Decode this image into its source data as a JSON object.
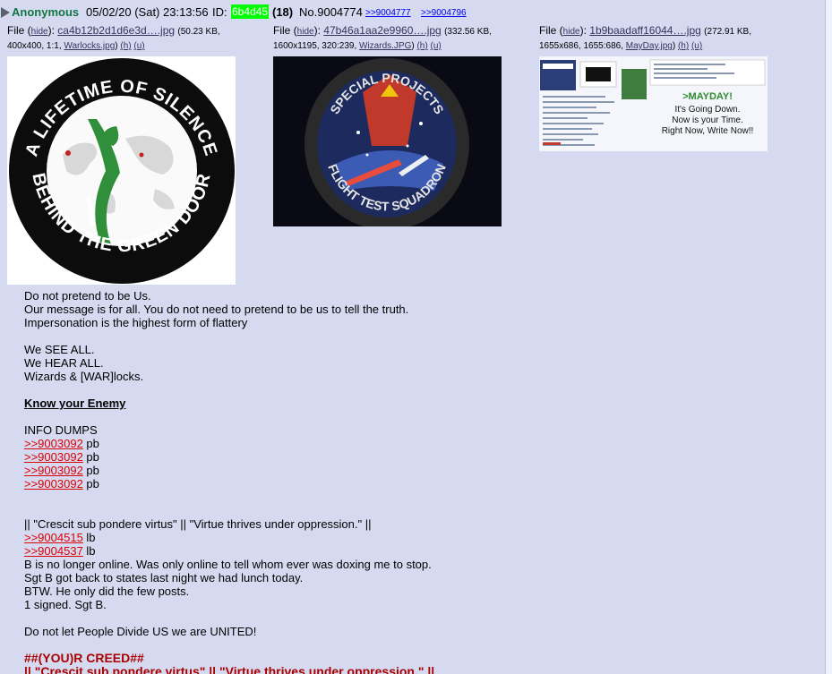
{
  "post": {
    "name": "Anonymous",
    "date": "05/02/20 (Sat) 23:13:56",
    "id_label": "ID:",
    "id": "6b4d45",
    "count": "(18)",
    "number": "No.9004774",
    "backlinks": [
      ">>9004777",
      ">>9004796"
    ]
  },
  "files": [
    {
      "label": "File (",
      "hide": "hide",
      "sep": "):",
      "name": "ca4b12b2d1d6e3d….jpg",
      "size": "(50.23 KB,",
      "dims": "400x400, 1:1,",
      "orig": "Warlocks.jpg",
      "h": "(h)",
      "u": "(u)",
      "image": {
        "ring_top_text": "A LIFETIME OF SILENCE",
        "ring_bottom_text": "BEHIND THE GREEN DOOR",
        "colors": {
          "ring": "#0c0c0c",
          "map": "#d8d8d8",
          "figure": "#2f8f3b",
          "accent": "#c81e1e"
        }
      }
    },
    {
      "label": "File (",
      "hide": "hide",
      "sep": "):",
      "name": "47b46a1aa2e9960….jpg",
      "size": "(332.56 KB,",
      "dims": "1600x1195, 320:239,",
      "orig": "Wizards.JPG",
      "h": "(h)",
      "u": "(u)",
      "image": {
        "top_text": "SPECIAL PROJECTS",
        "bottom_text": "FLIGHT TEST SQUADRON",
        "colors": {
          "bg": "#0a0a14",
          "patch": "#1d2a5e",
          "wizard": "#c0392b",
          "stars": "#ffffff"
        }
      }
    },
    {
      "label": "File (",
      "hide": "hide",
      "sep": "):",
      "name": "1b9baadaff16044….jpg",
      "size": "(272.91 KB,",
      "dims": "1655x686, 1655:686,",
      "orig": "MayDay.jpg",
      "h": "(h)",
      "u": "(u)",
      "image": {
        "headline": ">MAYDAY!",
        "line1": "It's Going Down.",
        "line2": "Now is your Time.",
        "line3": "Right Now, Write Now!!",
        "colors": {
          "headline": "#2e8b2e",
          "text": "#111111"
        }
      }
    }
  ],
  "message": {
    "p1": [
      "Do not pretend to be Us.",
      "Our message is for all. You do not need to pretend to be us to tell the truth.",
      "Impersonation is the highest form of flattery"
    ],
    "p2": [
      "We SEE ALL.",
      "We HEAR ALL.",
      "Wizards & [WAR]locks."
    ],
    "know": "Know your Enemy",
    "info": "INFO DUMPS",
    "dumps": [
      {
        "link": ">>9003092",
        "suffix": " pb"
      },
      {
        "link": ">>9003092",
        "suffix": " pb"
      },
      {
        "link": ">>9003092",
        "suffix": " pb"
      },
      {
        "link": ">>9003092",
        "suffix": " pb"
      }
    ],
    "motto": "|| \"Crescit sub pondere virtus\" || \"Virtue thrives under oppression.\" ||",
    "lbs": [
      {
        "link": ">>9004515",
        "suffix": " lb"
      },
      {
        "link": ">>9004537",
        "suffix": " lb"
      }
    ],
    "p3": [
      "B is no longer online. Was only online to tell whom ever was doxing me to stop.",
      "Sgt B got back to states last night we had lunch today.",
      "BTW. He only did the few posts.",
      "1 signed. Sgt B."
    ],
    "p4": "Do not let People Divide US we are UNITED!",
    "creed": "##(YOU)R CREED##",
    "creed2": "|| \"Crescit sub pondere virtus\" || \"Virtue thrives under oppression.\" ||"
  }
}
